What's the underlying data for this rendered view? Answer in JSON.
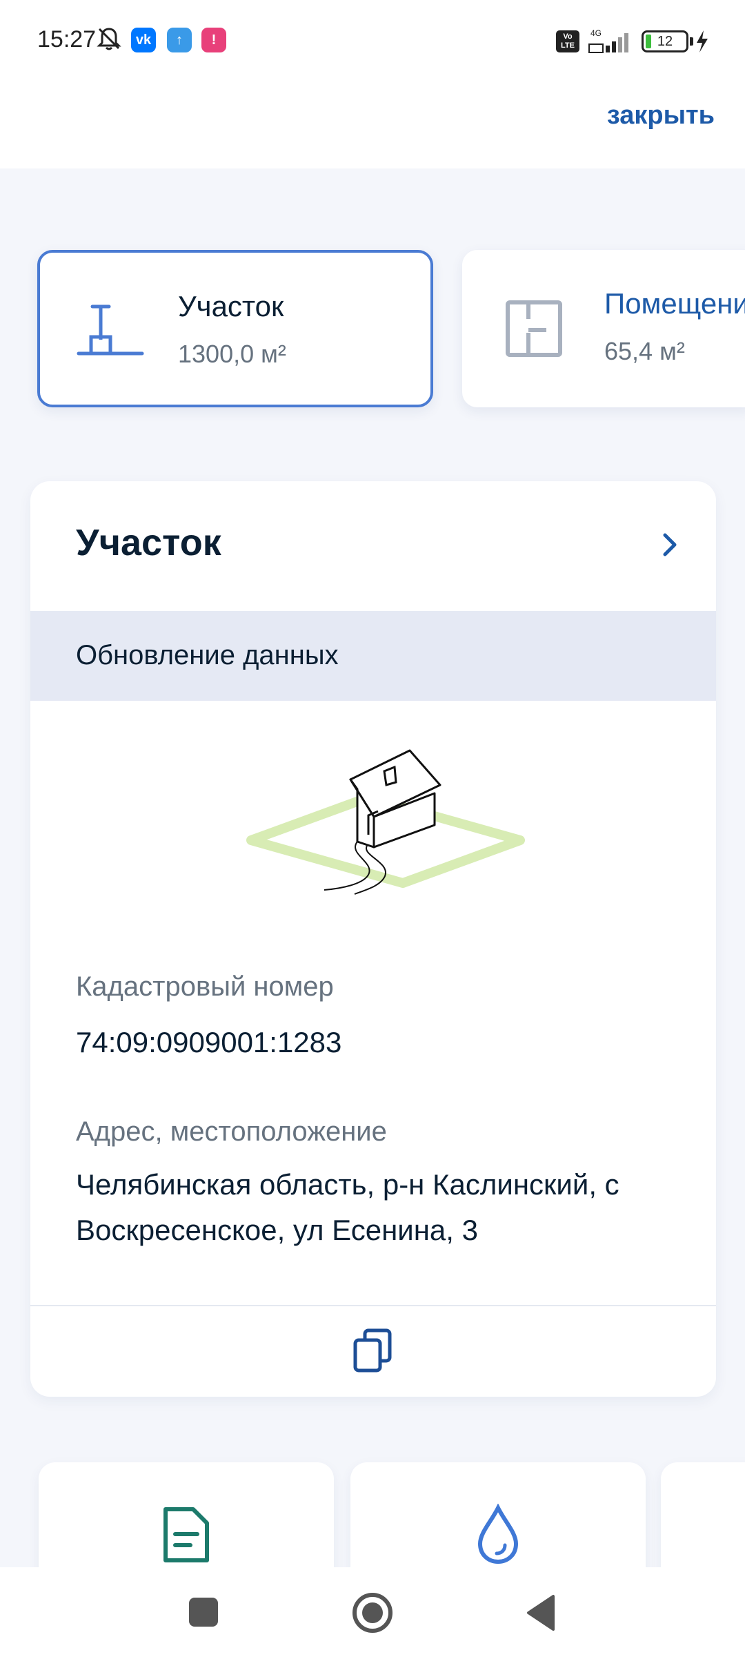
{
  "status_bar": {
    "time": "15:27",
    "apps": [
      {
        "name": "vk-icon",
        "label": "vk",
        "color": "#0077ff"
      },
      {
        "name": "upload-icon",
        "label": "↑",
        "color": "#3a9ae8"
      },
      {
        "name": "app-icon",
        "label": "!",
        "color": "#e8407a"
      }
    ],
    "volte": "Vo\nLTE",
    "network": "4G",
    "battery": "12"
  },
  "top_bar": {
    "close_label": "закрыть"
  },
  "objects": [
    {
      "title": "Участок",
      "sub": "1300,0 м²",
      "active": true,
      "icon": "plot-icon"
    },
    {
      "title": "Помещени",
      "sub": "65,4 м²",
      "active": false,
      "icon": "floorplan-icon"
    }
  ],
  "card": {
    "title": "Участок",
    "update_label": "Обновление данных",
    "cadastral_label": "Кадастровый номер",
    "cadastral_value": "74:09:0909001:1283",
    "address_label": "Адрес, местоположение",
    "address_value": "Челябинская область, р-н Каслинский, с Воскресенское, ул Есенина, 3"
  },
  "tiles": [
    {
      "icon": "document-icon",
      "color": "#1c7a6b"
    },
    {
      "icon": "water-drop-icon",
      "color": "#3f78d6"
    },
    {
      "icon": "tile-icon",
      "color": "#3f78d6"
    }
  ],
  "colors": {
    "accent": "#1d5aa8",
    "active_border": "#4a7bd3",
    "band": "#e5e9f4",
    "background": "#f4f6fb"
  }
}
